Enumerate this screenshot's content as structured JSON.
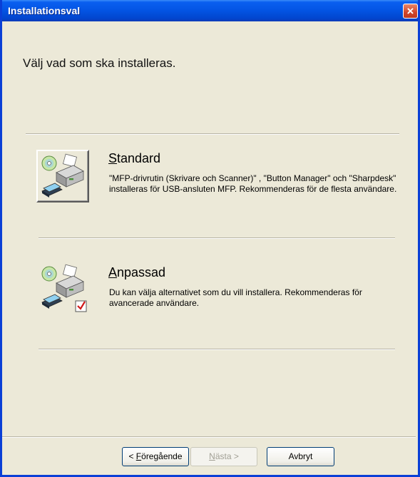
{
  "window": {
    "title": "Installationsval",
    "close_symbol": "×"
  },
  "heading": "Välj vad som ska installeras.",
  "options": [
    {
      "title_key": "S",
      "title_rest": "tandard",
      "description": "\"MFP-drivrutin (Skrivare och Scanner)\" , \"Button Manager\" och \"Sharpdesk\" installeras för USB-ansluten MFP. Rekommenderas för de flesta användare.",
      "icon": "printer-scanner-cd-icon"
    },
    {
      "title_key": "A",
      "title_rest": "npassad",
      "description": "Du kan välja alternativet som du vill installera. Rekommenderas för avancerade användare.",
      "icon": "printer-scanner-cd-checkbox-icon"
    }
  ],
  "buttons": {
    "back_prefix": "< ",
    "back_key": "F",
    "back_rest": "öregående",
    "next_key": "N",
    "next_rest": "ästa >",
    "cancel": "Avbryt"
  },
  "colors": {
    "titlebar": "#0354e3",
    "face": "#ece9d8",
    "close": "#d2452a"
  }
}
